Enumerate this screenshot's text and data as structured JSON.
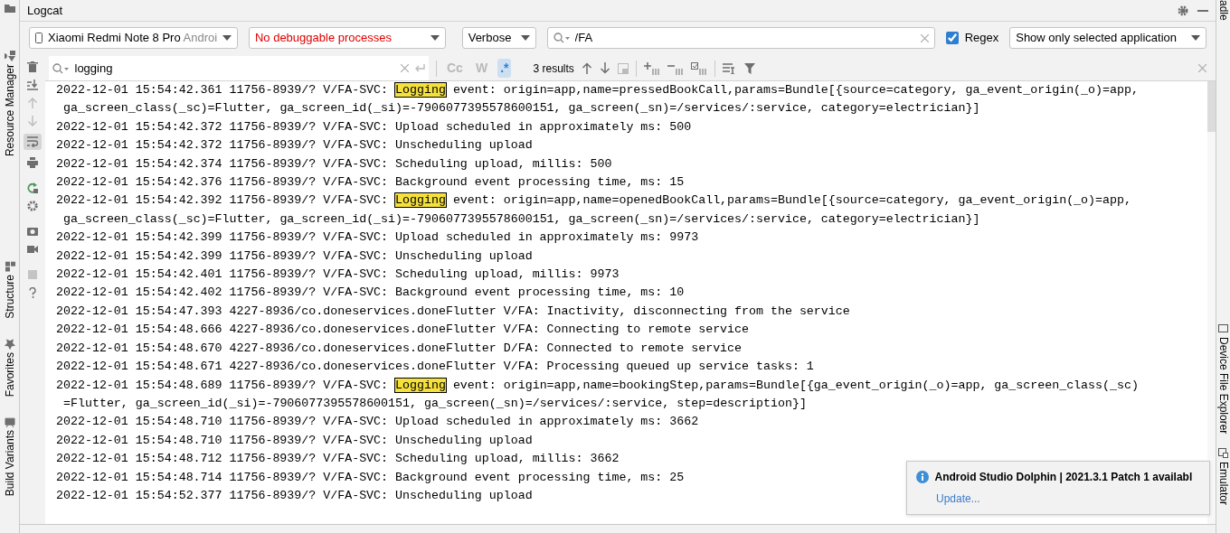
{
  "tool_window": {
    "title": "Logcat"
  },
  "left_stripe": [
    {
      "label": "Resource Manager"
    },
    {
      "label": "Structure"
    },
    {
      "label": "Favorites"
    },
    {
      "label": "Build Variants"
    }
  ],
  "right_stripe": [
    {
      "label": "adle"
    },
    {
      "label": "Device File Explorer"
    },
    {
      "label": "Emulator"
    }
  ],
  "device_select": {
    "value": "Xiaomi Redmi Note 8 Pro",
    "suffix": "Androi"
  },
  "process_select": {
    "value": "No debuggable processes"
  },
  "level_select": {
    "value": "Verbose"
  },
  "filter": {
    "value": "/FA"
  },
  "regex_filter": {
    "label": "Regex",
    "checked": true
  },
  "app_filter": {
    "value": "Show only selected application"
  },
  "soft_wrap": {
    "on": true
  },
  "find_bar": {
    "query": "logging",
    "match_case": {
      "label": "Cc",
      "on": false
    },
    "words": {
      "label": "W",
      "on": false
    },
    "regex": {
      "label": ".*",
      "on": true
    },
    "results": "3 results"
  },
  "log_lines": [
    {
      "kind": "match",
      "before": "2022-12-01 15:54:42.361 11756-8939/? V/FA-SVC: ",
      "match": "Logging",
      "after": " event: origin=app,name=pressedBookCall,params=Bundle[{source=category, ga_event_origin(_o)=app, ga_screen_class(_sc)=Flutter, ga_screen_id(_si)=-7906077395578600151, ga_screen(_sn)=/services/:service, category=electrician}]"
    },
    {
      "kind": "plain",
      "text": "2022-12-01 15:54:42.372 11756-8939/? V/FA-SVC: Upload scheduled in approximately ms: 500"
    },
    {
      "kind": "plain",
      "text": "2022-12-01 15:54:42.372 11756-8939/? V/FA-SVC: Unscheduling upload"
    },
    {
      "kind": "plain",
      "text": "2022-12-01 15:54:42.374 11756-8939/? V/FA-SVC: Scheduling upload, millis: 500"
    },
    {
      "kind": "plain",
      "text": "2022-12-01 15:54:42.376 11756-8939/? V/FA-SVC: Background event processing time, ms: 15"
    },
    {
      "kind": "match",
      "before": "2022-12-01 15:54:42.392 11756-8939/? V/FA-SVC: ",
      "match": "Logging",
      "after": " event: origin=app,name=openedBookCall,params=Bundle[{source=category, ga_event_origin(_o)=app, ga_screen_class(_sc)=Flutter, ga_screen_id(_si)=-7906077395578600151, ga_screen(_sn)=/services/:service, category=electrician}]"
    },
    {
      "kind": "plain",
      "text": "2022-12-01 15:54:42.399 11756-8939/? V/FA-SVC: Upload scheduled in approximately ms: 9973"
    },
    {
      "kind": "plain",
      "text": "2022-12-01 15:54:42.399 11756-8939/? V/FA-SVC: Unscheduling upload"
    },
    {
      "kind": "plain",
      "text": "2022-12-01 15:54:42.401 11756-8939/? V/FA-SVC: Scheduling upload, millis: 9973"
    },
    {
      "kind": "plain",
      "text": "2022-12-01 15:54:42.402 11756-8939/? V/FA-SVC: Background event processing time, ms: 10"
    },
    {
      "kind": "plain",
      "text": "2022-12-01 15:54:47.393 4227-8936/co.doneservices.doneFlutter V/FA: Inactivity, disconnecting from the service"
    },
    {
      "kind": "plain",
      "text": "2022-12-01 15:54:48.666 4227-8936/co.doneservices.doneFlutter V/FA: Connecting to remote service"
    },
    {
      "kind": "plain",
      "text": "2022-12-01 15:54:48.670 4227-8936/co.doneservices.doneFlutter D/FA: Connected to remote service"
    },
    {
      "kind": "plain",
      "text": "2022-12-01 15:54:48.671 4227-8936/co.doneservices.doneFlutter V/FA: Processing queued up service tasks: 1"
    },
    {
      "kind": "match",
      "before": "2022-12-01 15:54:48.689 11756-8939/? V/FA-SVC: ",
      "match": "Logging",
      "after": " event: origin=app,name=bookingStep,params=Bundle[{ga_event_origin(_o)=app, ga_screen_class(_sc) =Flutter, ga_screen_id(_si)=-7906077395578600151, ga_screen(_sn)=/services/:service, step=description}]"
    },
    {
      "kind": "plain",
      "text": "2022-12-01 15:54:48.710 11756-8939/? V/FA-SVC: Upload scheduled in approximately ms: 3662"
    },
    {
      "kind": "plain",
      "text": "2022-12-01 15:54:48.710 11756-8939/? V/FA-SVC: Unscheduling upload"
    },
    {
      "kind": "plain",
      "text": "2022-12-01 15:54:48.712 11756-8939/? V/FA-SVC: Scheduling upload, millis: 3662"
    },
    {
      "kind": "plain",
      "text": "2022-12-01 15:54:48.714 11756-8939/? V/FA-SVC: Background event processing time, ms: 25"
    },
    {
      "kind": "plain",
      "text": "2022-12-01 15:54:52.377 11756-8939/? V/FA-SVC: Unscheduling upload"
    }
  ],
  "notification": {
    "title": "Android Studio Dolphin | 2021.3.1 Patch 1 availabl",
    "link": "Update..."
  }
}
